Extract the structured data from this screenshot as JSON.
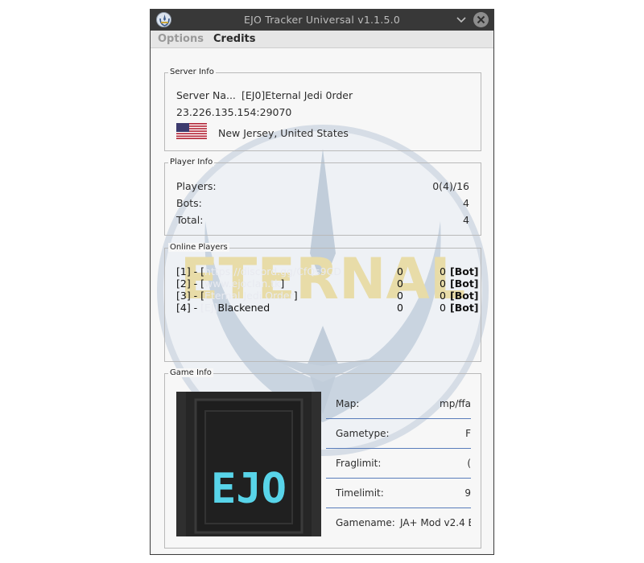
{
  "window": {
    "title": "EJO Tracker Universal v1.1.5.0"
  },
  "menu": {
    "options": "Options",
    "credits": "Credits"
  },
  "server_info": {
    "group_title": "Server Info",
    "name_label": "Server Na...",
    "name_value": "[EJ0]Eternal Jedi 0rder",
    "address": "23.226.135.154:29070",
    "location": "New Jersey, United States",
    "flag_icon": "us-flag-icon"
  },
  "player_info": {
    "group_title": "Player Info",
    "rows": [
      {
        "label": "Players:",
        "value": "0(4)/16"
      },
      {
        "label": "Bots:",
        "value": "4"
      },
      {
        "label": "Total:",
        "value": "4"
      }
    ]
  },
  "online_players": {
    "group_title": "Online Players",
    "players": [
      {
        "prefix": "[1] - [",
        "name": "https://discord.gg/CfQs9CD",
        "name_tail": "",
        "score": "0",
        "ping": "0",
        "tag": "[Bot]"
      },
      {
        "prefix": "[2] - [",
        "name": "www.ejoclan.tk",
        "name_tail": "]",
        "score": "0",
        "ping": "0",
        "tag": "[Bot]"
      },
      {
        "prefix": "[3] - [",
        "name": "Eternal Jedi Order",
        "name_tail": "]",
        "score": "0",
        "ping": "0",
        "tag": "[Bot]"
      },
      {
        "prefix": "[4] - ",
        "name": "[EJ]",
        "name_tail": "Blackened",
        "score": "0",
        "ping": "0",
        "tag": "[Bot]"
      }
    ],
    "watermark_text": "ETERNAL"
  },
  "game_info": {
    "group_title": "Game Info",
    "levelshot_text": "EJO",
    "rows": [
      {
        "label": "Map:",
        "value": "mp/ffa"
      },
      {
        "label": "Gametype:",
        "value": "F"
      },
      {
        "label": "Fraglimit:",
        "value": "("
      },
      {
        "label": "Timelimit:",
        "value": "9"
      },
      {
        "label": "Gamename:",
        "value": "JA+ Mod v2.4 B"
      }
    ]
  },
  "colors": {
    "titlebar": "#383838",
    "accent_line": "#5a7dbb",
    "watermark_gold": "#e8d9a0",
    "watermark_blue": "#b9c8d8",
    "levelshot_glow": "#5fe8ff"
  }
}
